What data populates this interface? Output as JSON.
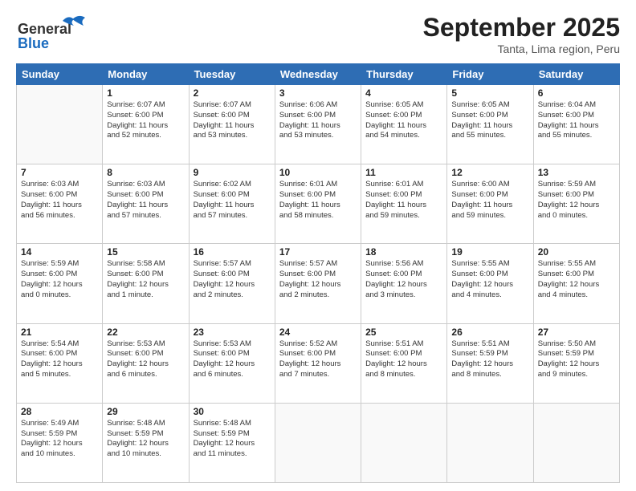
{
  "header": {
    "logo_general": "General",
    "logo_blue": "Blue",
    "main_title": "September 2025",
    "subtitle": "Tanta, Lima region, Peru"
  },
  "days_of_week": [
    "Sunday",
    "Monday",
    "Tuesday",
    "Wednesday",
    "Thursday",
    "Friday",
    "Saturday"
  ],
  "weeks": [
    [
      {
        "day": "",
        "info": ""
      },
      {
        "day": "1",
        "info": "Sunrise: 6:07 AM\nSunset: 6:00 PM\nDaylight: 11 hours\nand 52 minutes."
      },
      {
        "day": "2",
        "info": "Sunrise: 6:07 AM\nSunset: 6:00 PM\nDaylight: 11 hours\nand 53 minutes."
      },
      {
        "day": "3",
        "info": "Sunrise: 6:06 AM\nSunset: 6:00 PM\nDaylight: 11 hours\nand 53 minutes."
      },
      {
        "day": "4",
        "info": "Sunrise: 6:05 AM\nSunset: 6:00 PM\nDaylight: 11 hours\nand 54 minutes."
      },
      {
        "day": "5",
        "info": "Sunrise: 6:05 AM\nSunset: 6:00 PM\nDaylight: 11 hours\nand 55 minutes."
      },
      {
        "day": "6",
        "info": "Sunrise: 6:04 AM\nSunset: 6:00 PM\nDaylight: 11 hours\nand 55 minutes."
      }
    ],
    [
      {
        "day": "7",
        "info": "Sunrise: 6:03 AM\nSunset: 6:00 PM\nDaylight: 11 hours\nand 56 minutes."
      },
      {
        "day": "8",
        "info": "Sunrise: 6:03 AM\nSunset: 6:00 PM\nDaylight: 11 hours\nand 57 minutes."
      },
      {
        "day": "9",
        "info": "Sunrise: 6:02 AM\nSunset: 6:00 PM\nDaylight: 11 hours\nand 57 minutes."
      },
      {
        "day": "10",
        "info": "Sunrise: 6:01 AM\nSunset: 6:00 PM\nDaylight: 11 hours\nand 58 minutes."
      },
      {
        "day": "11",
        "info": "Sunrise: 6:01 AM\nSunset: 6:00 PM\nDaylight: 11 hours\nand 59 minutes."
      },
      {
        "day": "12",
        "info": "Sunrise: 6:00 AM\nSunset: 6:00 PM\nDaylight: 11 hours\nand 59 minutes."
      },
      {
        "day": "13",
        "info": "Sunrise: 5:59 AM\nSunset: 6:00 PM\nDaylight: 12 hours\nand 0 minutes."
      }
    ],
    [
      {
        "day": "14",
        "info": "Sunrise: 5:59 AM\nSunset: 6:00 PM\nDaylight: 12 hours\nand 0 minutes."
      },
      {
        "day": "15",
        "info": "Sunrise: 5:58 AM\nSunset: 6:00 PM\nDaylight: 12 hours\nand 1 minute."
      },
      {
        "day": "16",
        "info": "Sunrise: 5:57 AM\nSunset: 6:00 PM\nDaylight: 12 hours\nand 2 minutes."
      },
      {
        "day": "17",
        "info": "Sunrise: 5:57 AM\nSunset: 6:00 PM\nDaylight: 12 hours\nand 2 minutes."
      },
      {
        "day": "18",
        "info": "Sunrise: 5:56 AM\nSunset: 6:00 PM\nDaylight: 12 hours\nand 3 minutes."
      },
      {
        "day": "19",
        "info": "Sunrise: 5:55 AM\nSunset: 6:00 PM\nDaylight: 12 hours\nand 4 minutes."
      },
      {
        "day": "20",
        "info": "Sunrise: 5:55 AM\nSunset: 6:00 PM\nDaylight: 12 hours\nand 4 minutes."
      }
    ],
    [
      {
        "day": "21",
        "info": "Sunrise: 5:54 AM\nSunset: 6:00 PM\nDaylight: 12 hours\nand 5 minutes."
      },
      {
        "day": "22",
        "info": "Sunrise: 5:53 AM\nSunset: 6:00 PM\nDaylight: 12 hours\nand 6 minutes."
      },
      {
        "day": "23",
        "info": "Sunrise: 5:53 AM\nSunset: 6:00 PM\nDaylight: 12 hours\nand 6 minutes."
      },
      {
        "day": "24",
        "info": "Sunrise: 5:52 AM\nSunset: 6:00 PM\nDaylight: 12 hours\nand 7 minutes."
      },
      {
        "day": "25",
        "info": "Sunrise: 5:51 AM\nSunset: 6:00 PM\nDaylight: 12 hours\nand 8 minutes."
      },
      {
        "day": "26",
        "info": "Sunrise: 5:51 AM\nSunset: 5:59 PM\nDaylight: 12 hours\nand 8 minutes."
      },
      {
        "day": "27",
        "info": "Sunrise: 5:50 AM\nSunset: 5:59 PM\nDaylight: 12 hours\nand 9 minutes."
      }
    ],
    [
      {
        "day": "28",
        "info": "Sunrise: 5:49 AM\nSunset: 5:59 PM\nDaylight: 12 hours\nand 10 minutes."
      },
      {
        "day": "29",
        "info": "Sunrise: 5:48 AM\nSunset: 5:59 PM\nDaylight: 12 hours\nand 10 minutes."
      },
      {
        "day": "30",
        "info": "Sunrise: 5:48 AM\nSunset: 5:59 PM\nDaylight: 12 hours\nand 11 minutes."
      },
      {
        "day": "",
        "info": ""
      },
      {
        "day": "",
        "info": ""
      },
      {
        "day": "",
        "info": ""
      },
      {
        "day": "",
        "info": ""
      }
    ]
  ]
}
